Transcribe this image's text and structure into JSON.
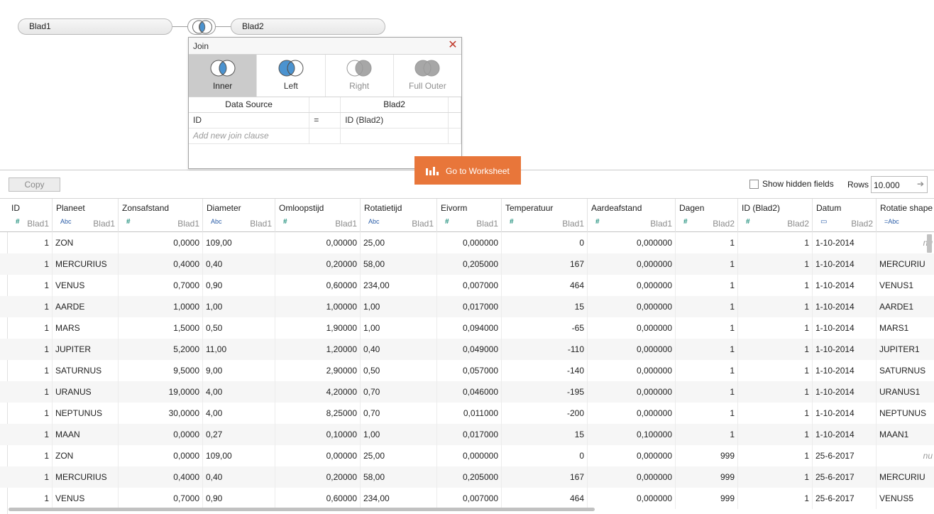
{
  "canvas": {
    "left_table": "Blad1",
    "right_table": "Blad2"
  },
  "join_dialog": {
    "title": "Join",
    "close": "✕",
    "types": [
      {
        "label": "Inner",
        "state": "active"
      },
      {
        "label": "Left",
        "state": "enabled"
      },
      {
        "label": "Right",
        "state": "disabled"
      },
      {
        "label": "Full Outer",
        "state": "disabled"
      }
    ],
    "headers": {
      "left": "Data Source",
      "right": "Blad2"
    },
    "clause": {
      "left": "ID",
      "op": "=",
      "right": "ID (Blad2)"
    },
    "add_clause_placeholder": "Add new join clause",
    "colors": {
      "venn_fill": "#4b93d0",
      "venn_disabled": "#a7a7a7"
    }
  },
  "go_to_worksheet": {
    "label": "Go to Worksheet",
    "color": "#e8763a"
  },
  "toolbar": {
    "copy_label": "Copy",
    "show_hidden_label": "Show hidden fields",
    "show_hidden_checked": false,
    "rows_label": "Rows",
    "rows_value": "10.000"
  },
  "grid": {
    "columns": [
      {
        "name": "ID",
        "type": "#",
        "source": "Blad1",
        "align": "num"
      },
      {
        "name": "Planeet",
        "type": "Abc",
        "source": "Blad1",
        "align": "text"
      },
      {
        "name": "Zonsafstand",
        "type": "#",
        "source": "Blad1",
        "align": "num"
      },
      {
        "name": "Diameter",
        "type": "Abc",
        "source": "Blad1",
        "align": "text"
      },
      {
        "name": "Omloopstijd",
        "type": "#",
        "source": "Blad1",
        "align": "num"
      },
      {
        "name": "Rotatietijd",
        "type": "Abc",
        "source": "Blad1",
        "align": "text"
      },
      {
        "name": "Eivorm",
        "type": "#",
        "source": "Blad1",
        "align": "num"
      },
      {
        "name": "Temperatuur",
        "type": "#",
        "source": "Blad1",
        "align": "num"
      },
      {
        "name": "Aardeafstand",
        "type": "#",
        "source": "Blad1",
        "align": "num"
      },
      {
        "name": "Dagen",
        "type": "#",
        "source": "Blad2",
        "align": "num"
      },
      {
        "name": "ID (Blad2)",
        "type": "#",
        "source": "Blad2",
        "align": "num"
      },
      {
        "name": "Datum",
        "type": "date",
        "source": "Blad2",
        "align": "text"
      },
      {
        "name": "Rotatie shape",
        "type": "=Abc",
        "source": "",
        "align": "text"
      }
    ],
    "rows": [
      [
        "1",
        "ZON",
        "0,0000",
        "109,00",
        "0,00000",
        "25,00",
        "0,000000",
        "0",
        "0,000000",
        "1",
        "1",
        "1-10-2014",
        "nu"
      ],
      [
        "1",
        "MERCURIUS",
        "0,4000",
        "0,40",
        "0,20000",
        "58,00",
        "0,205000",
        "167",
        "0,000000",
        "1",
        "1",
        "1-10-2014",
        "MERCURIU"
      ],
      [
        "1",
        "VENUS",
        "0,7000",
        "0,90",
        "0,60000",
        "234,00",
        "0,007000",
        "464",
        "0,000000",
        "1",
        "1",
        "1-10-2014",
        "VENUS1"
      ],
      [
        "1",
        "AARDE",
        "1,0000",
        "1,00",
        "1,00000",
        "1,00",
        "0,017000",
        "15",
        "0,000000",
        "1",
        "1",
        "1-10-2014",
        "AARDE1"
      ],
      [
        "1",
        "MARS",
        "1,5000",
        "0,50",
        "1,90000",
        "1,00",
        "0,094000",
        "-65",
        "0,000000",
        "1",
        "1",
        "1-10-2014",
        "MARS1"
      ],
      [
        "1",
        "JUPITER",
        "5,2000",
        "11,00",
        "1,20000",
        "0,40",
        "0,049000",
        "-110",
        "0,000000",
        "1",
        "1",
        "1-10-2014",
        "JUPITER1"
      ],
      [
        "1",
        "SATURNUS",
        "9,5000",
        "9,00",
        "2,90000",
        "0,50",
        "0,057000",
        "-140",
        "0,000000",
        "1",
        "1",
        "1-10-2014",
        "SATURNUS"
      ],
      [
        "1",
        "URANUS",
        "19,0000",
        "4,00",
        "4,20000",
        "0,70",
        "0,046000",
        "-195",
        "0,000000",
        "1",
        "1",
        "1-10-2014",
        "URANUS1"
      ],
      [
        "1",
        "NEPTUNUS",
        "30,0000",
        "4,00",
        "8,25000",
        "0,70",
        "0,011000",
        "-200",
        "0,000000",
        "1",
        "1",
        "1-10-2014",
        "NEPTUNUS"
      ],
      [
        "1",
        "MAAN",
        "0,0000",
        "0,27",
        "0,10000",
        "1,00",
        "0,017000",
        "15",
        "0,100000",
        "1",
        "1",
        "1-10-2014",
        "MAAN1"
      ],
      [
        "1",
        "ZON",
        "0,0000",
        "109,00",
        "0,00000",
        "25,00",
        "0,000000",
        "0",
        "0,000000",
        "999",
        "1",
        "25-6-2017",
        "nu"
      ],
      [
        "1",
        "MERCURIUS",
        "0,4000",
        "0,40",
        "0,20000",
        "58,00",
        "0,205000",
        "167",
        "0,000000",
        "999",
        "1",
        "25-6-2017",
        "MERCURIU"
      ],
      [
        "1",
        "VENUS",
        "0,7000",
        "0,90",
        "0,60000",
        "234,00",
        "0,007000",
        "464",
        "0,000000",
        "999",
        "1",
        "25-6-2017",
        "VENUS5"
      ]
    ]
  }
}
